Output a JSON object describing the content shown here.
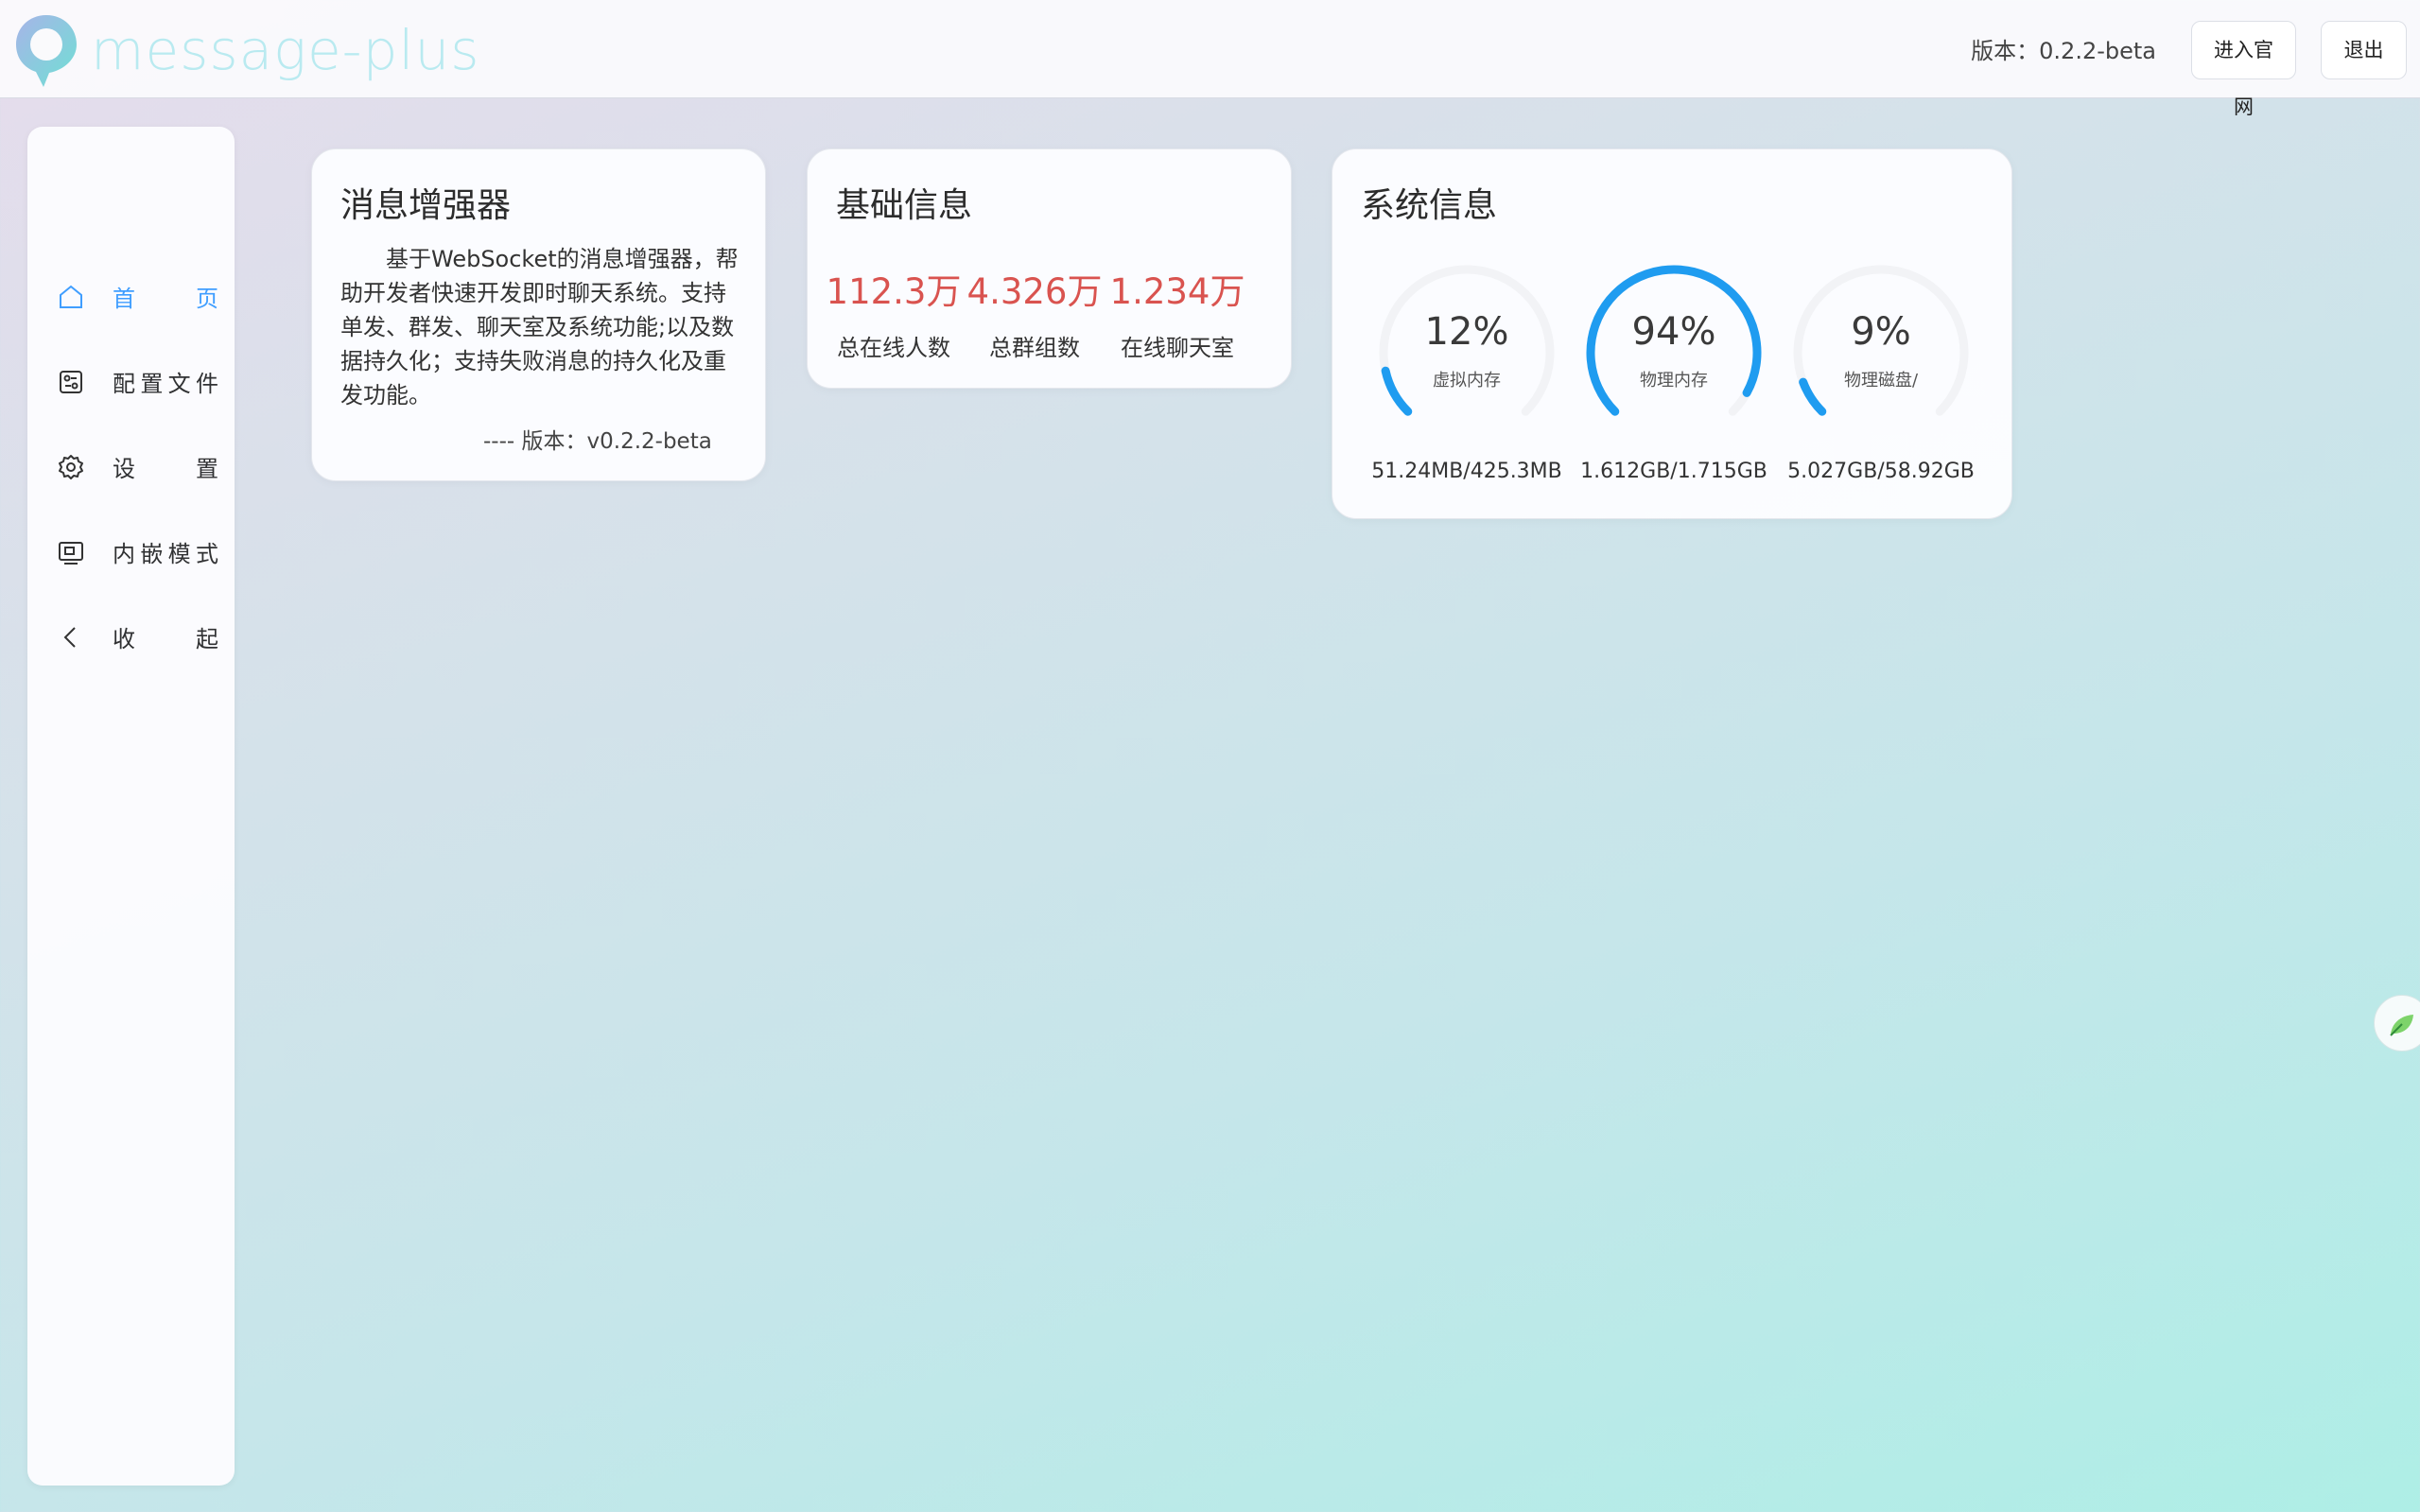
{
  "header": {
    "logo_text": "message-plus",
    "version": "版本：0.2.2-beta",
    "site_button": "进入官网",
    "exit_button": "退出"
  },
  "sidebar": {
    "items": [
      {
        "label": "首页",
        "icon": "home-icon",
        "active": true
      },
      {
        "label": "配置文件",
        "icon": "config-file-icon",
        "active": false
      },
      {
        "label": "设置",
        "icon": "gear-icon",
        "active": false
      },
      {
        "label": "内嵌模式",
        "icon": "embed-icon",
        "active": false
      },
      {
        "label": "收起",
        "icon": "chevron-left-icon",
        "active": false
      }
    ]
  },
  "intro_card": {
    "title": "消息增强器",
    "body": "基于WebSocket的消息增强器，帮助开发者快速开发即时聊天系统。支持单发、群发、聊天室及系统功能;以及数据持久化；支持失败消息的持久化及重发功能。",
    "version": "---- 版本：v0.2.2-beta"
  },
  "basic_card": {
    "title": "基础信息",
    "stats": [
      {
        "value": "112.3万",
        "label": "总在线人数"
      },
      {
        "value": "4.326万",
        "label": "总群组数"
      },
      {
        "value": "1.234万",
        "label": "在线聊天室"
      }
    ]
  },
  "system_card": {
    "title": "系统信息",
    "gauges": [
      {
        "percent": "12%",
        "value": 12,
        "name": "虚拟内存",
        "detail": "51.24MB/425.3MB"
      },
      {
        "percent": "94%",
        "value": 94,
        "name": "物理内存",
        "detail": "1.612GB/1.715GB"
      },
      {
        "percent": "9%",
        "value": 9,
        "name": "物理磁盘/",
        "detail": "5.027GB/58.92GB"
      }
    ]
  },
  "colors": {
    "accent": "#409eff",
    "gauge": "#1f9cf0",
    "stat_value": "#d9534f",
    "logo": "#7fd8e0"
  }
}
